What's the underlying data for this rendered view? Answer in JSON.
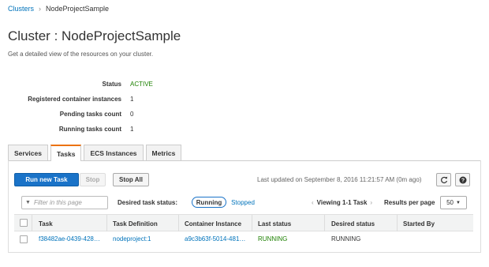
{
  "breadcrumb": {
    "root": "Clusters",
    "separator": "›",
    "current": "NodeProjectSample"
  },
  "page": {
    "title": "Cluster : NodeProjectSample",
    "subtitle": "Get a detailed view of the resources on your cluster."
  },
  "summary": [
    {
      "label": "Status",
      "value": "ACTIVE"
    },
    {
      "label": "Registered container instances",
      "value": "1"
    },
    {
      "label": "Pending tasks count",
      "value": "0"
    },
    {
      "label": "Running tasks count",
      "value": "1"
    }
  ],
  "tabs": [
    "Services",
    "Tasks",
    "ECS Instances",
    "Metrics"
  ],
  "active_tab": "Tasks",
  "toolbar": {
    "run_new_task": "Run new Task",
    "stop": "Stop",
    "stop_all": "Stop All",
    "last_updated": "Last updated on September 8, 2016 11:21:57 AM (0m ago)"
  },
  "filter": {
    "placeholder": "Filter in this page",
    "desired_status_label": "Desired task status:",
    "running": "Running",
    "stopped": "Stopped"
  },
  "pagination": {
    "viewing": "Viewing 1-1 Task",
    "prev": "‹",
    "next": "›",
    "results_per_page_label": "Results per page",
    "results_per_page_value": "50"
  },
  "table": {
    "columns": [
      "Task",
      "Task Definition",
      "Container Instance",
      "Last status",
      "Desired status",
      "Started By"
    ],
    "rows": [
      {
        "task": "f38482ae-0439-428…",
        "task_definition": "nodeproject:1",
        "container_instance": "a9c3b63f-5014-481…",
        "last_status": "RUNNING",
        "desired_status": "RUNNING",
        "started_by": ""
      }
    ]
  },
  "colors": {
    "link": "#0073bb",
    "primary": "#1a73c8",
    "active_tab": "#ec7211",
    "status_green": "#1d8102"
  },
  "icons": {
    "refresh": "refresh-icon",
    "help": "help-icon",
    "filter": "filter-icon",
    "dropdown": "chevron-down-icon"
  }
}
